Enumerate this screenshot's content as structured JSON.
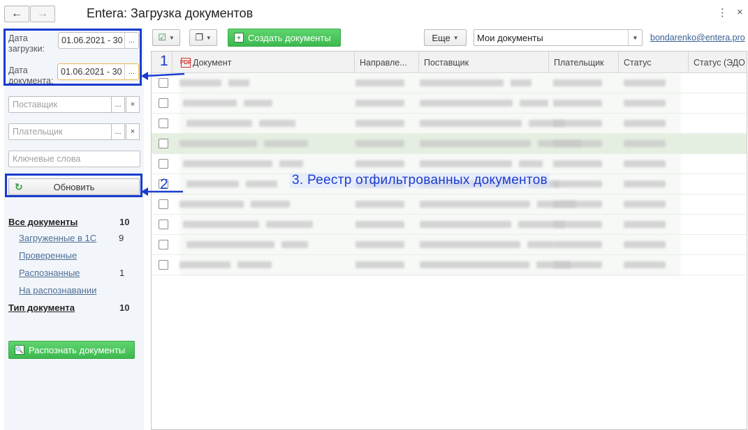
{
  "window": {
    "title": "Entera: Загрузка документов",
    "back_icon": "←",
    "forward_icon": "→",
    "menu_icon": "⋮",
    "close_icon": "×"
  },
  "filters": {
    "upload_date_label": "Дата загрузки:",
    "upload_date_value": "01.06.2021 - 30",
    "doc_date_label": "Дата документа:",
    "doc_date_value": "01.06.2021 - 30",
    "dots": "...",
    "clear": "×",
    "supplier_placeholder": "Поставщик",
    "payer_placeholder": "Плательщик",
    "keywords_placeholder": "Ключевые слова",
    "refresh_label": "Обновить"
  },
  "nav": {
    "all_docs": {
      "label": "Все документы",
      "count": "10"
    },
    "loaded_1c": {
      "label": "Загруженные в 1С",
      "count": "9"
    },
    "checked": {
      "label": "Проверенные",
      "count": ""
    },
    "recognized": {
      "label": "Распознанные",
      "count": "1"
    },
    "in_recognition": {
      "label": "На распознавании",
      "count": ""
    },
    "doc_type": {
      "label": "Тип документа",
      "count": "10"
    }
  },
  "recognize_button": "Распознать документы",
  "toolbar": {
    "create_docs": "Создать документы",
    "more": "Еще",
    "filter_value": "Мои документы",
    "user": "bondarenko@entera.pro"
  },
  "table": {
    "columns": [
      "Документ",
      "Направле...",
      "Поставщик",
      "Плательщик",
      "Статус",
      "Статус (ЭДО"
    ],
    "row_count": 10
  },
  "overlay_caption": "3. Реестр отфильтрованных документов",
  "annotations": {
    "n1": "1",
    "n2": "2"
  },
  "colors": {
    "accent_blue": "#1a3ccf",
    "green": "#3cb94e",
    "link": "#4f6f95"
  }
}
